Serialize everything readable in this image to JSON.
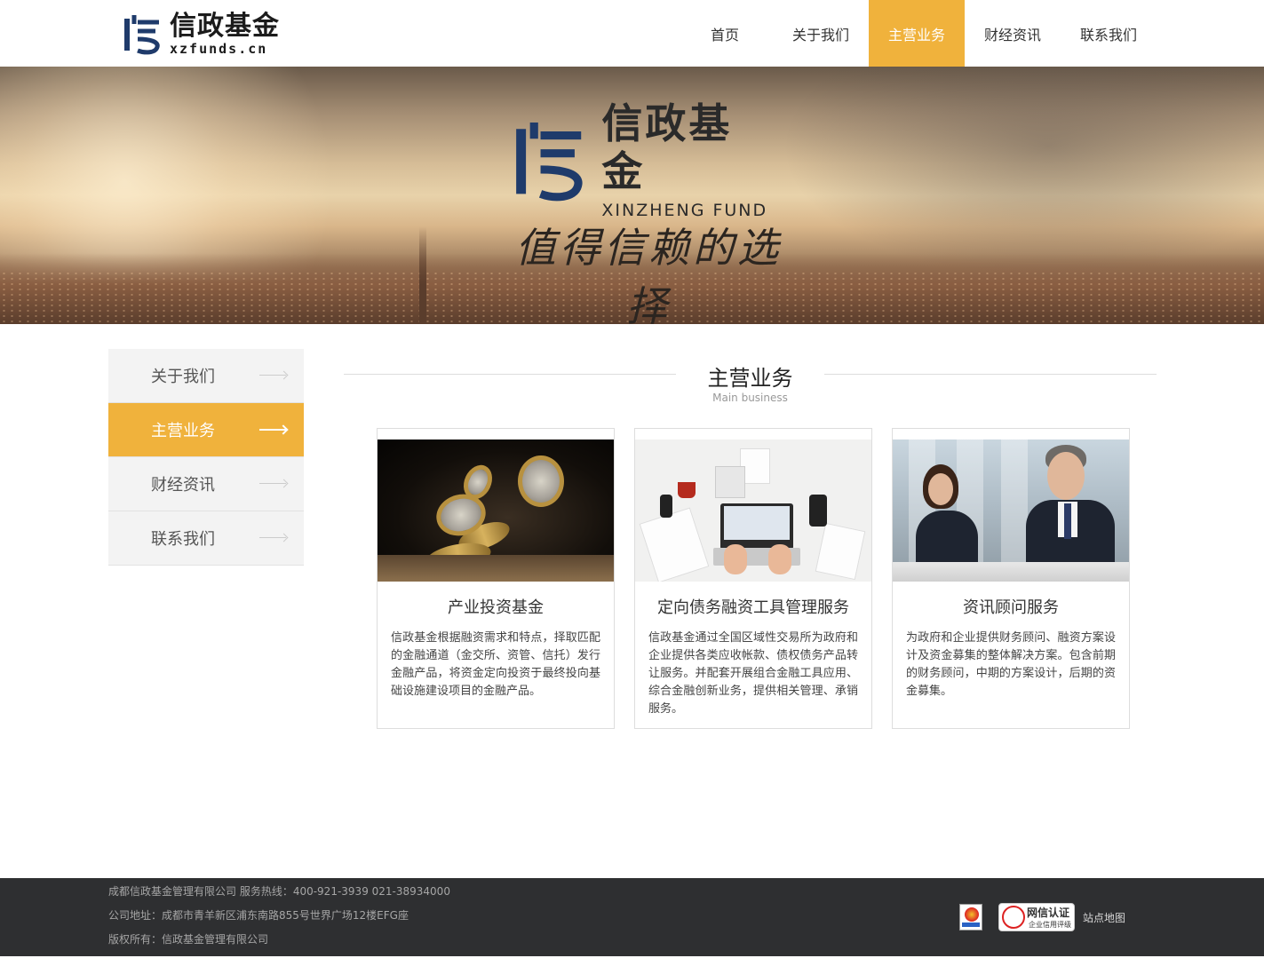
{
  "brand": {
    "name_cn": "信政基金",
    "domain": "xzfunds.cn",
    "brand_color": "#1f3b6b",
    "accent_color": "#f0b23c"
  },
  "nav": {
    "items": [
      {
        "label": "首页"
      },
      {
        "label": "关于我们"
      },
      {
        "label": "主营业务"
      },
      {
        "label": "财经资讯"
      },
      {
        "label": "联系我们"
      }
    ],
    "active": "主营业务"
  },
  "banner": {
    "title_cn": "信政基金",
    "title_en": "XINZHENG FUND",
    "slogan": "值得信赖的选择"
  },
  "sidebar": {
    "items": [
      {
        "label": "关于我们"
      },
      {
        "label": "主营业务"
      },
      {
        "label": "财经资讯"
      },
      {
        "label": "联系我们"
      }
    ],
    "active": "主营业务"
  },
  "section": {
    "title_cn": "主营业务",
    "title_en": "Main business"
  },
  "cards": [
    {
      "title": "产业投资基金",
      "desc": "信政基金根据融资需求和特点，择取匹配的金融通道（金交所、资管、信托）发行金融产品，将资金定向投资于最终投向基础设施建设项目的金融产品。",
      "image": "coins-photo"
    },
    {
      "title": "定向债务融资工具管理服务",
      "desc": "信政基金通过全国区域性交易所为政府和企业提供各类应收帐款、债权债务产品转让服务。并配套开展组合金融工具应用、综合金融创新业务，提供相关管理、承销服务。",
      "image": "desk-laptop-photo"
    },
    {
      "title": "资讯顾问服务",
      "desc": "为政府和企业提供财务顾问、融资方案设计及资金募集的整体解决方案。包含前期的财务顾问，中期的方案设计，后期的资金募集。",
      "image": "business-people-photo"
    }
  ],
  "footer": {
    "line1": "成都信政基金管理有限公司 服务热线：400-921-3939 021-38934000",
    "line2": "公司地址：成都市青羊新区浦东南路855号世界广场12楼EFG座",
    "line3": "版权所有：信政基金管理有限公司",
    "badge_main": "网信认证",
    "badge_sub": "企业信用评级",
    "sitemap": "站点地图"
  }
}
